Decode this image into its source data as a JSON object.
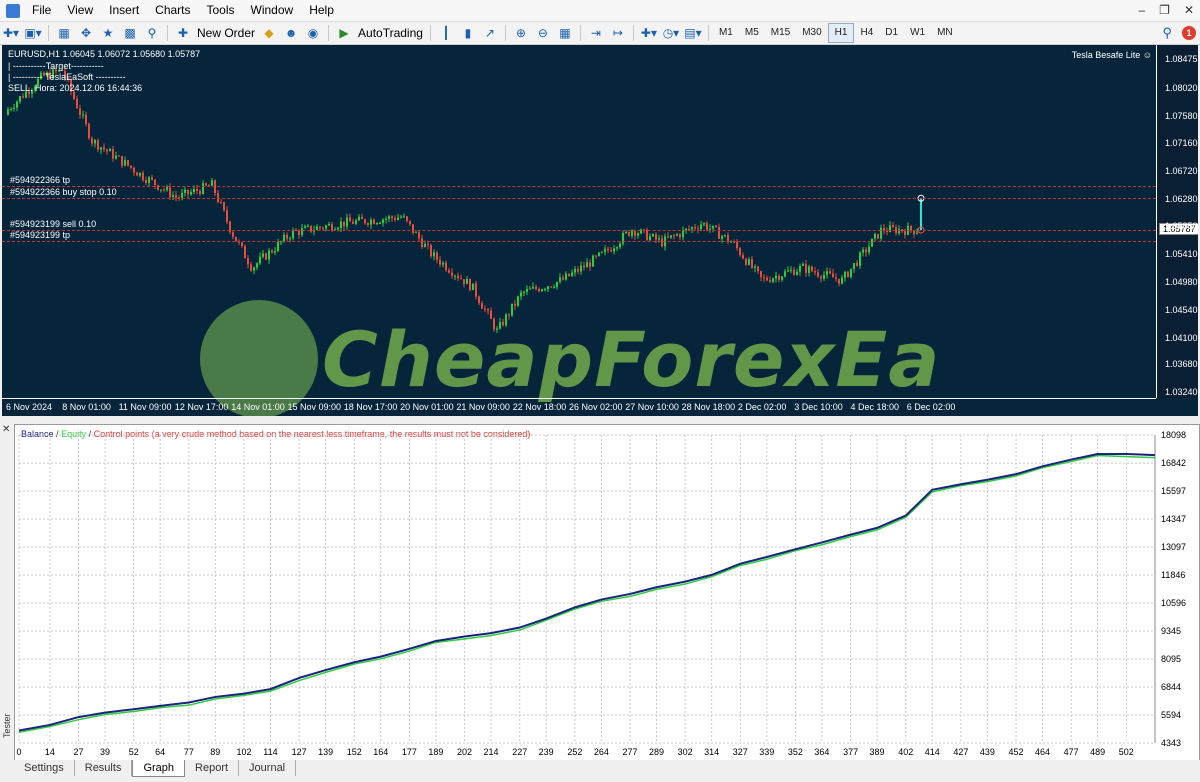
{
  "menubar": {
    "items": [
      "File",
      "View",
      "Insert",
      "Charts",
      "Tools",
      "Window",
      "Help"
    ]
  },
  "toolbar": {
    "new_order_label": "New Order",
    "autotrading_label": "AutoTrading",
    "timeframes": [
      "M1",
      "M5",
      "M15",
      "M30",
      "H1",
      "H4",
      "D1",
      "W1",
      "MN"
    ],
    "active_timeframe": "H1",
    "notification_count": "1"
  },
  "chart": {
    "symbol_line": "EURUSD,H1  1.06045 1.06072 1.05680 1.05787",
    "info_lines": [
      "| -----------Target-----------",
      "| ---------- TeslaEaSoft ----------",
      "SELL. Hora: 2024.12.06 16:44:36"
    ],
    "ea_name": "Tesla Besafe Lite",
    "current_price": "1.05787",
    "price_labels": [
      "1.08475",
      "1.08020",
      "1.07580",
      "1.07160",
      "1.06720",
      "1.06280",
      "1.05850",
      "1.05410",
      "1.04980",
      "1.04540",
      "1.04100",
      "1.03680",
      "1.03240"
    ],
    "time_labels": [
      "6 Nov 2024",
      "8 Nov 01:00",
      "11 Nov 09:00",
      "12 Nov 17:00",
      "14 Nov 01:00",
      "15 Nov 09:00",
      "18 Nov 17:00",
      "20 Nov 01:00",
      "21 Nov 09:00",
      "22 Nov 18:00",
      "26 Nov 02:00",
      "27 Nov 10:00",
      "28 Nov 18:00",
      "2 Dec 02:00",
      "3 Dec 10:00",
      "4 Dec 18:00",
      "6 Dec 02:00"
    ],
    "levels": [
      {
        "label": "#594922366 tp",
        "price": 1.0648
      },
      {
        "label": "#594922366 buy stop 0.10",
        "price": 1.0629
      },
      {
        "label": "#594923199 sell 0.10",
        "price": 1.0579
      },
      {
        "label": "#594923199 tp",
        "price": 1.0562
      }
    ],
    "watermark_text": "CheapForexEa",
    "colors": {
      "background": "#06243a",
      "bull": "#2ecc40",
      "bear": "#e74c3c",
      "level": "#c0392b"
    }
  },
  "graph": {
    "legend": {
      "balance": "Balance",
      "equity": "Equity",
      "control": "Control points (a very crude method based on the nearest less timeframe, the results must not be considered)"
    },
    "y_labels": [
      "18098",
      "16842",
      "15597",
      "14347",
      "13097",
      "11846",
      "10596",
      "9345",
      "8095",
      "6844",
      "5594",
      "4343"
    ],
    "x_labels": [
      "0",
      "14",
      "27",
      "39",
      "52",
      "64",
      "77",
      "89",
      "102",
      "114",
      "127",
      "139",
      "152",
      "164",
      "177",
      "189",
      "202",
      "214",
      "227",
      "239",
      "252",
      "264",
      "277",
      "289",
      "302",
      "314",
      "327",
      "339",
      "352",
      "364",
      "377",
      "389",
      "402",
      "414",
      "427",
      "439",
      "452",
      "464",
      "477",
      "489",
      "502"
    ],
    "colors": {
      "balance": "#1a237e",
      "equity": "#2ecc40",
      "control": "#e53935"
    }
  },
  "tester_label": "Tester",
  "tabs": [
    "Settings",
    "Results",
    "Graph",
    "Report",
    "Journal"
  ],
  "active_tab": "Graph",
  "chart_data": [
    {
      "type": "line",
      "title": "",
      "xlabel": "",
      "ylabel": "",
      "x": [
        0,
        14,
        27,
        39,
        52,
        64,
        77,
        89,
        102,
        114,
        127,
        139,
        152,
        164,
        177,
        189,
        202,
        214,
        227,
        239,
        252,
        264,
        277,
        289,
        302,
        314,
        327,
        339,
        352,
        364,
        377,
        389,
        402,
        414,
        427,
        439,
        452,
        464,
        477,
        489,
        502,
        515
      ],
      "series": [
        {
          "name": "Balance",
          "values": [
            4900,
            5150,
            5500,
            5700,
            5850,
            6000,
            6150,
            6400,
            6550,
            6750,
            7250,
            7600,
            7950,
            8200,
            8550,
            8900,
            9100,
            9250,
            9500,
            9900,
            10400,
            10750,
            11000,
            11300,
            11550,
            11850,
            12350,
            12650,
            13000,
            13300,
            13650,
            13950,
            14500,
            15650,
            15900,
            16100,
            16350,
            16700,
            17000,
            17250,
            17250,
            17200
          ]
        }
      ],
      "ylim": [
        4343,
        18098
      ],
      "grid": true
    }
  ]
}
